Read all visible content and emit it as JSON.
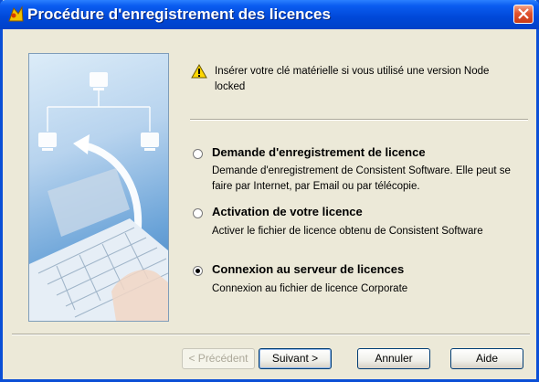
{
  "window": {
    "title": "Procédure d'enregistrement des licences"
  },
  "warning": {
    "icon": "warning-icon",
    "text": "Insérer votre clé matérielle si vous utilisé une version Node locked"
  },
  "options": [
    {
      "title": "Demande d'enregistrement de licence",
      "description": "Demande d'enregistrement de Consistent Software. Elle peut se faire par Internet, par Email ou par télécopie.",
      "selected": false
    },
    {
      "title": "Activation de votre licence",
      "description": "Activer le fichier de licence obtenu de Consistent Software",
      "selected": false
    },
    {
      "title": "Connexion au serveur de licences",
      "description": "Connexion au fichier de licence Corporate",
      "selected": true
    }
  ],
  "buttons": {
    "previous": "< Précédent",
    "next": "Suivant >",
    "cancel": "Annuler",
    "help": "Aide"
  },
  "colors": {
    "titlebar": "#0048d8",
    "close": "#e0522e",
    "dialog_bg": "#ece9d8"
  }
}
